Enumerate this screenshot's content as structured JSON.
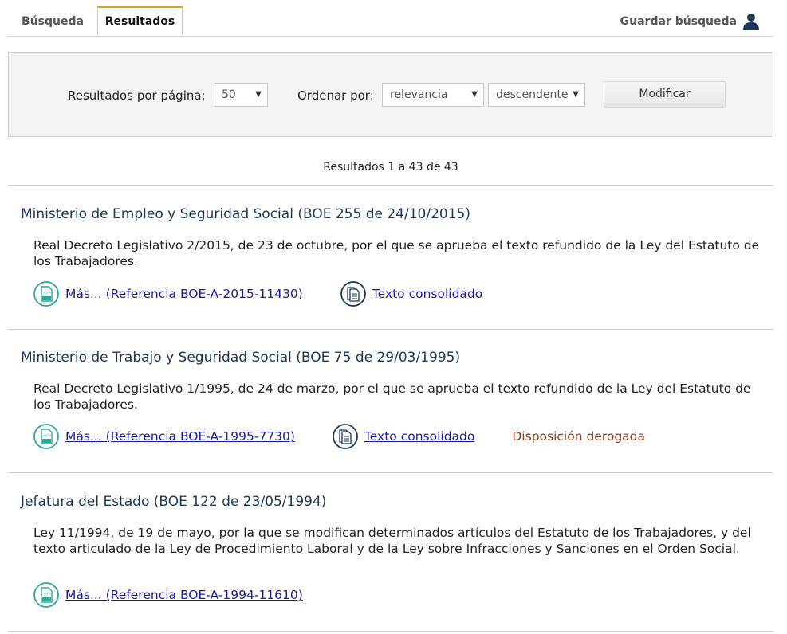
{
  "tabs": [
    {
      "label": "Búsqueda"
    },
    {
      "label": "Resultados"
    }
  ],
  "save_search": {
    "label": "Guardar búsqueda",
    "icon": "user-icon"
  },
  "options": {
    "per_page_label": "Resultados por página:",
    "per_page_value": "50",
    "order_label": "Ordenar por:",
    "order_value": "relevancia",
    "direction_value": "descendente",
    "modify_button": "Modificar"
  },
  "results_count": "Resultados 1 a 43 de 43",
  "results": [
    {
      "title": "Ministerio de Empleo y Seguridad Social (BOE 255 de 24/10/2015)",
      "description": "Real Decreto Legislativo 2/2015, de 23 de octubre, por el que se aprueba el texto refundido de la Ley del Estatuto de los Trabajadores.",
      "more_link": "Más... (Referencia BOE-A-2015-11430)",
      "consolidated_link": "Texto consolidado"
    },
    {
      "title": "Ministerio de Trabajo y Seguridad Social (BOE 75 de 29/03/1995)",
      "description": "Real Decreto Legislativo 1/1995, de 24 de marzo, por el que se aprueba el texto refundido de la Ley del Estatuto de los Trabajadores.",
      "more_link": "Más... (Referencia BOE-A-1995-7730)",
      "consolidated_link": "Texto consolidado",
      "status": "Disposición derogada"
    },
    {
      "title": "Jefatura del Estado (BOE 122 de 23/05/1994)",
      "description": "Ley 11/1994, de 19 de mayo, por la que se modifican determinados artículos del Estatuto de los Trabajadores, y del texto articulado de la Ley de Procedimiento Laboral y de la Ley sobre Infracciones y Sanciones en el Orden Social.",
      "more_link": "Más... (Referencia BOE-A-1994-11610)"
    }
  ],
  "colors": {
    "tab_accent": "#e0a020",
    "title": "#1d3557",
    "link": "#1a1aa6",
    "html_icon": "#2aa89a",
    "doc_icon": "#1d3557",
    "derogated": "#8b3a20"
  }
}
